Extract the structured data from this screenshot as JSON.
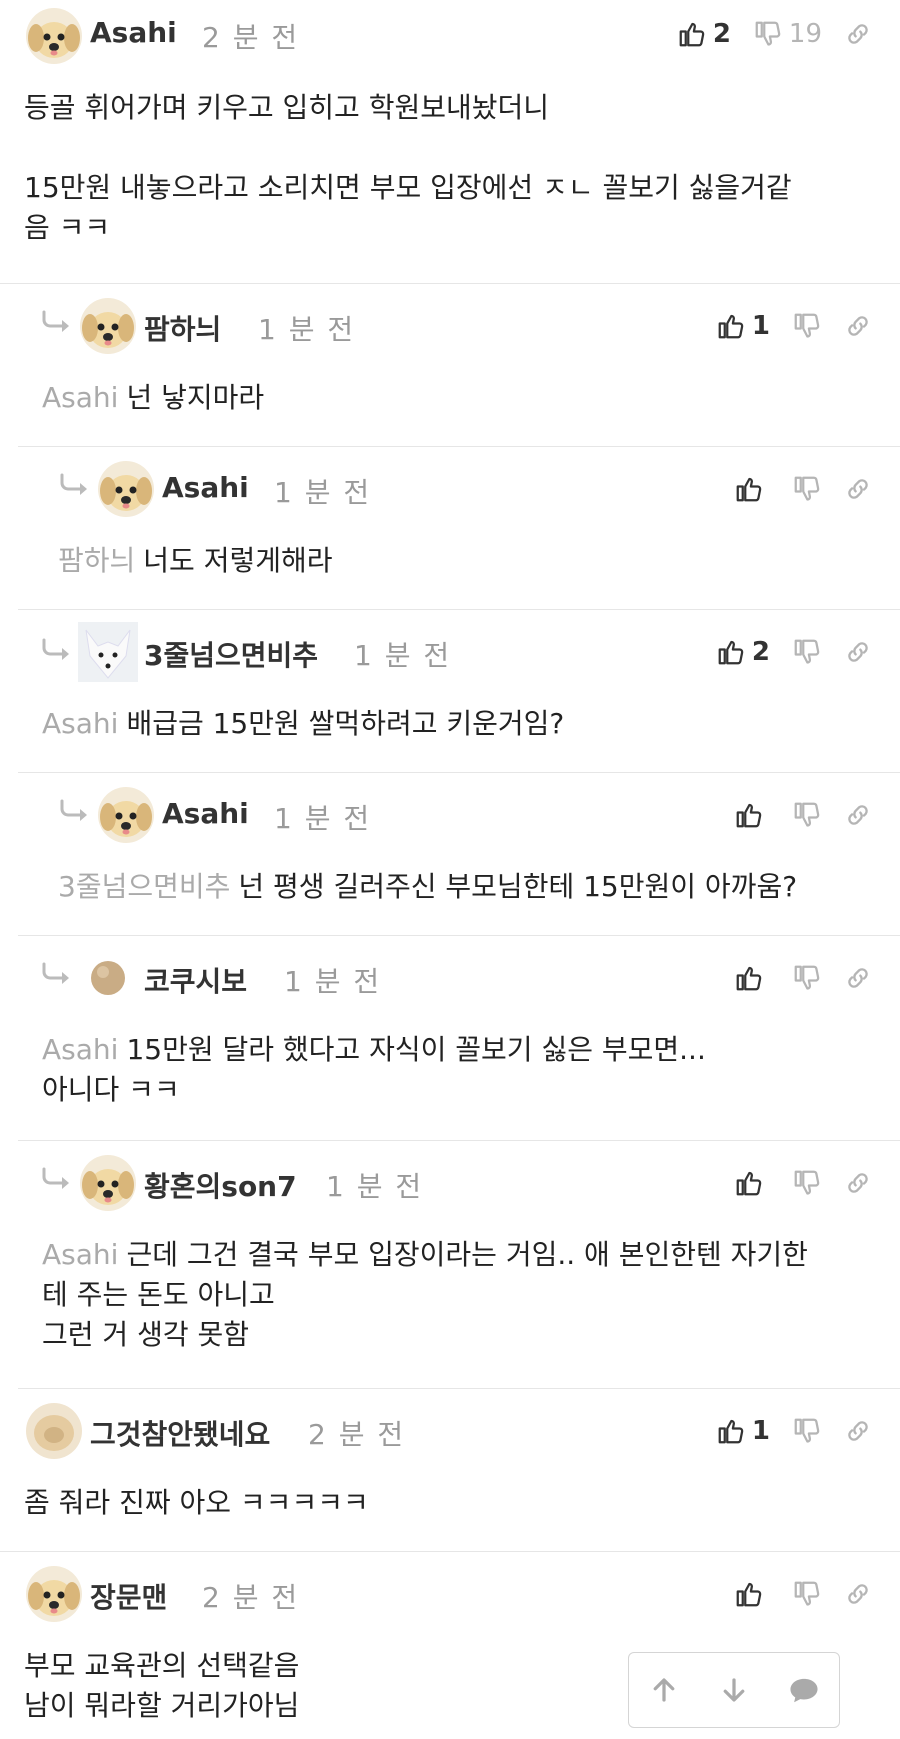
{
  "comments": [
    {
      "author": "Asahi",
      "time": "2 분 전",
      "likes": "2",
      "dislikes": "19",
      "lines": [
        "등골 휘어가며 키우고 입히고 학원보내놨더니",
        "",
        "15만원 내놓으라고 소리치면 부모 입장에선 ㅈㄴ 꼴보기 싫을거같",
        "음 ㅋㅋ"
      ]
    },
    {
      "author": "팜하늬",
      "time": "1 분 전",
      "likes": "1",
      "mention": "Asahi",
      "lines": [
        "넌 낳지마라"
      ]
    },
    {
      "author": "Asahi",
      "time": "1 분 전",
      "mention": "팜하늬",
      "lines": [
        "너도 저렇게해라"
      ]
    },
    {
      "author": "3줄넘으면비추",
      "time": "1 분 전",
      "likes": "2",
      "mention": "Asahi",
      "lines": [
        "배급금 15만원 쌀먹하려고 키운거임?"
      ]
    },
    {
      "author": "Asahi",
      "time": "1 분 전",
      "mention": "3줄넘으면비추",
      "lines": [
        "넌 평생 길러주신 부모님한테 15만원이 아까움?"
      ]
    },
    {
      "author": "코쿠시보",
      "time": "1 분 전",
      "mention": "Asahi",
      "lines": [
        "15만원 달라 했다고 자식이 꼴보기 싫은 부모면...",
        "아니다 ㅋㅋ"
      ]
    },
    {
      "author": "황혼의son7",
      "time": "1 분 전",
      "mention": "Asahi",
      "lines": [
        "근데 그건 결국 부모 입장이라는 거임.. 애 본인한텐 자기한",
        "테 주는 돈도 아니고",
        "그런 거 생각 못함"
      ]
    },
    {
      "author": "그것참안됐네요",
      "time": "2 분 전",
      "likes": "1",
      "lines": [
        "좀 줘라 진짜 아오 ㅋㅋㅋㅋㅋ"
      ]
    },
    {
      "author": "장문맨",
      "time": "2 분 전",
      "lines": [
        "부모 교육관의 선택같음",
        "남이 뭐라할 거리가아님"
      ]
    }
  ],
  "icons": {
    "like": "thumbs-up-icon",
    "dislike": "thumbs-down-icon",
    "link": "link-icon",
    "reply": "reply-arrow-icon",
    "up": "arrow-up-icon",
    "down": "arrow-down-icon",
    "comment": "comment-bubble-icon"
  },
  "colors": {
    "icon": "#333333",
    "muted_icon": "#b5b5b5",
    "mention": "#aaaaaa",
    "divider": "#e6e6e6"
  }
}
